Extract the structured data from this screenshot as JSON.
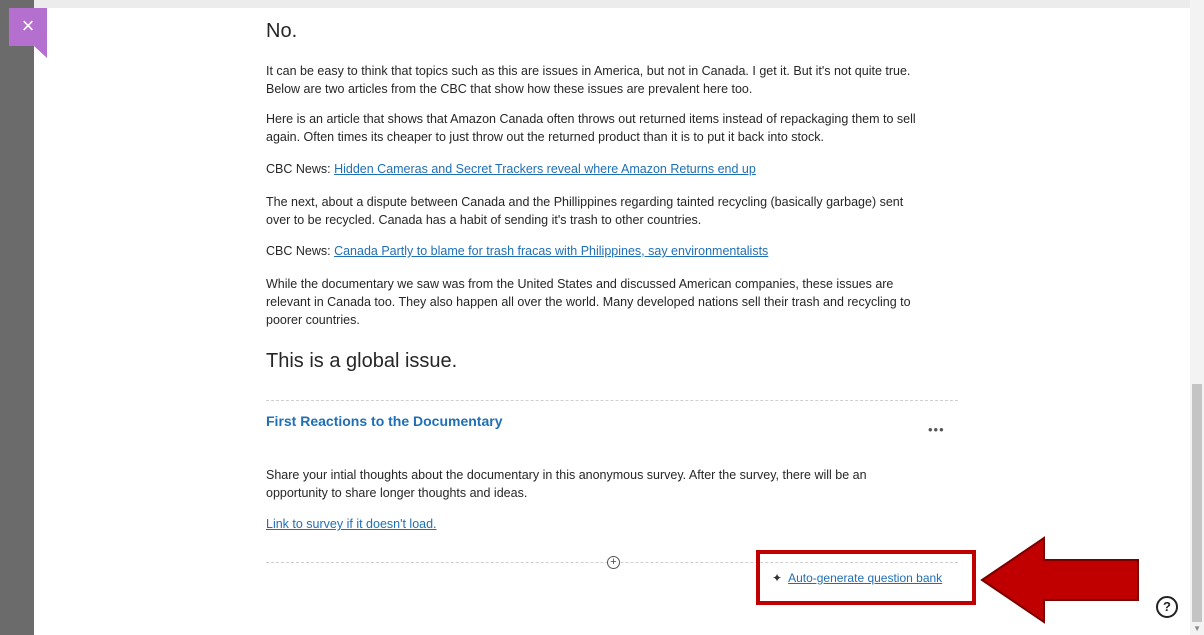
{
  "close_label": "×",
  "headings": {
    "no": "No.",
    "global": "This is a global issue."
  },
  "paragraphs": {
    "p1": "It can be easy to think that topics such as this are issues in America, but not in Canada. I get it. But it's not quite true. Below are two articles from the CBC that show how these issues are prevalent here too.",
    "p2": "Here is an article that shows that Amazon Canada often throws out returned items instead of repackaging them to sell again. Often times its cheaper to just throw out the returned product than it is to put it back into stock.",
    "p3": "The next, about a dispute between Canada and the Phillippines regarding tainted recycling (basically garbage) sent over to be recycled. Canada has a habit of sending it's trash to other countries.",
    "p4": "While the documentary we saw was from the United States and discussed American companies, these issues are relevant in Canada too. They also happen all over the world. Many developed nations sell their trash and recycling to poorer countries."
  },
  "cbc_links": {
    "prefix": "CBC News:",
    "link1": "Hidden Cameras and Secret Trackers reveal where Amazon Returns end up",
    "link2": "Canada Partly to blame for trash fracas with Philippines, say environmentalists"
  },
  "section": {
    "title": "First Reactions to the Documentary",
    "more": "•••",
    "description": "Share your intial thoughts about the documentary in this anonymous survey. After the survey, there will be an opportunity to share longer thoughts and ideas.",
    "survey_link": "Link to survey if it doesn't load."
  },
  "add_symbol": "+",
  "autogen_label": "Auto-generate question bank",
  "sparkle": "✦",
  "help_symbol": "?",
  "scroll_down": "▼",
  "colors": {
    "accent_purple": "#b56fcf",
    "link_blue": "#1f6fb6",
    "highlight_red": "#c00000"
  }
}
